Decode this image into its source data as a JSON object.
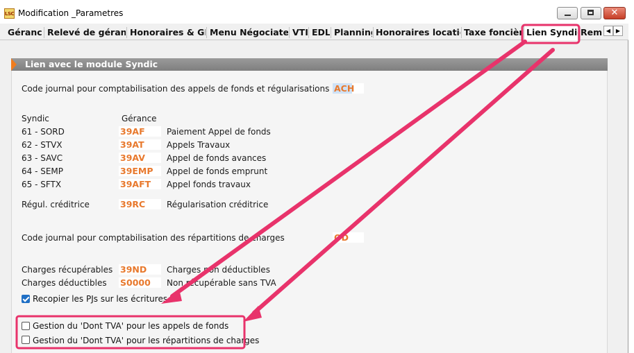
{
  "window": {
    "app_icon_text": "LSC",
    "title": "Modification _Parametres",
    "controls": {
      "minimize": "─",
      "maximize": "☐",
      "close": "✕"
    }
  },
  "tabs": [
    {
      "label": "Gérance",
      "active": false
    },
    {
      "label": "Relevé de gérance",
      "active": false
    },
    {
      "label": "Honoraires & GRL",
      "active": false
    },
    {
      "label": "Menu Négociateur",
      "active": false
    },
    {
      "label": "VTI",
      "active": false
    },
    {
      "label": "EDL",
      "active": false
    },
    {
      "label": "Planning",
      "active": false
    },
    {
      "label": "Honoraires location",
      "active": false
    },
    {
      "label": "Taxe foncière",
      "active": false
    },
    {
      "label": "Lien Syndic",
      "active": true
    },
    {
      "label": "Remb",
      "active": false
    }
  ],
  "tab_scroll": {
    "left": "◀",
    "right": "▶"
  },
  "section": {
    "title": "Lien avec le module Syndic"
  },
  "journal_appels": {
    "label": "Code journal pour comptabilisation des appels de fonds et régularisations",
    "value": "ACH"
  },
  "columns": {
    "syndic": "Syndic",
    "gerance": "Gérance"
  },
  "rows": [
    {
      "syndic": "61 - SORD",
      "code": "39AF",
      "description": "Paiement Appel de fonds"
    },
    {
      "syndic": "62 - STVX",
      "code": "39AT",
      "description": "Appels Travaux"
    },
    {
      "syndic": "63 - SAVC",
      "code": "39AV",
      "description": "Appel de fonds avances"
    },
    {
      "syndic": "64 - SEMP",
      "code": "39EMP",
      "description": "Appel de fonds emprunt"
    },
    {
      "syndic": "65 - SFTX",
      "code": "39AFT",
      "description": "Appel fonds travaux"
    }
  ],
  "regul": {
    "label": "Régul. créditrice",
    "code": "39RC",
    "description": "Régularisation créditrice"
  },
  "journal_repartitions": {
    "label": "Code journal pour comptabilisation des répartitions de charges",
    "value": "OD"
  },
  "charges": [
    {
      "label": "Charges récupérables",
      "code": "39ND",
      "description": "Charges non déductibles"
    },
    {
      "label": "Charges déductibles",
      "code": "S0000",
      "description": "Non récupérable sans TVA"
    }
  ],
  "checkboxes": [
    {
      "label": "Recopier les PJs sur les écritures",
      "checked": true
    },
    {
      "label": "Gestion du 'Dont TVA' pour les appels de fonds",
      "checked": false
    },
    {
      "label": "Gestion du 'Dont TVA' pour les répartitions de charges",
      "checked": false
    }
  ],
  "highlight_color": "#e8336b",
  "code_color": "#e8792d"
}
